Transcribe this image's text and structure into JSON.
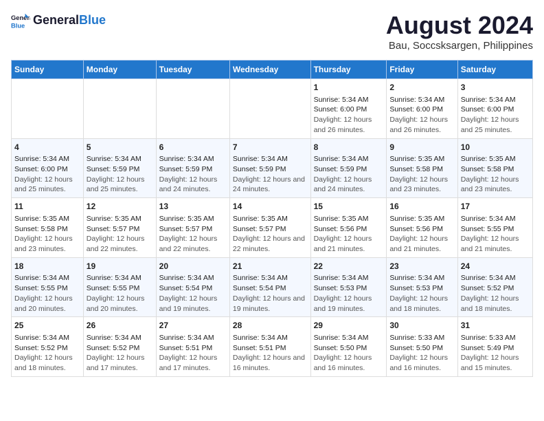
{
  "header": {
    "logo_line1": "General",
    "logo_line2": "Blue",
    "title": "August 2024",
    "subtitle": "Bau, Soccsksargen, Philippines"
  },
  "days": [
    "Sunday",
    "Monday",
    "Tuesday",
    "Wednesday",
    "Thursday",
    "Friday",
    "Saturday"
  ],
  "weeks": [
    {
      "cells": [
        {
          "empty": true
        },
        {
          "empty": true
        },
        {
          "empty": true
        },
        {
          "empty": true
        },
        {
          "day": 1,
          "sunrise": "5:34 AM",
          "sunset": "6:00 PM",
          "daylight": "12 hours and 26 minutes."
        },
        {
          "day": 2,
          "sunrise": "5:34 AM",
          "sunset": "6:00 PM",
          "daylight": "12 hours and 26 minutes."
        },
        {
          "day": 3,
          "sunrise": "5:34 AM",
          "sunset": "6:00 PM",
          "daylight": "12 hours and 25 minutes."
        }
      ]
    },
    {
      "cells": [
        {
          "day": 4,
          "sunrise": "5:34 AM",
          "sunset": "6:00 PM",
          "daylight": "12 hours and 25 minutes."
        },
        {
          "day": 5,
          "sunrise": "5:34 AM",
          "sunset": "5:59 PM",
          "daylight": "12 hours and 25 minutes."
        },
        {
          "day": 6,
          "sunrise": "5:34 AM",
          "sunset": "5:59 PM",
          "daylight": "12 hours and 24 minutes."
        },
        {
          "day": 7,
          "sunrise": "5:34 AM",
          "sunset": "5:59 PM",
          "daylight": "12 hours and 24 minutes."
        },
        {
          "day": 8,
          "sunrise": "5:34 AM",
          "sunset": "5:59 PM",
          "daylight": "12 hours and 24 minutes."
        },
        {
          "day": 9,
          "sunrise": "5:35 AM",
          "sunset": "5:58 PM",
          "daylight": "12 hours and 23 minutes."
        },
        {
          "day": 10,
          "sunrise": "5:35 AM",
          "sunset": "5:58 PM",
          "daylight": "12 hours and 23 minutes."
        }
      ]
    },
    {
      "cells": [
        {
          "day": 11,
          "sunrise": "5:35 AM",
          "sunset": "5:58 PM",
          "daylight": "12 hours and 23 minutes."
        },
        {
          "day": 12,
          "sunrise": "5:35 AM",
          "sunset": "5:57 PM",
          "daylight": "12 hours and 22 minutes."
        },
        {
          "day": 13,
          "sunrise": "5:35 AM",
          "sunset": "5:57 PM",
          "daylight": "12 hours and 22 minutes."
        },
        {
          "day": 14,
          "sunrise": "5:35 AM",
          "sunset": "5:57 PM",
          "daylight": "12 hours and 22 minutes."
        },
        {
          "day": 15,
          "sunrise": "5:35 AM",
          "sunset": "5:56 PM",
          "daylight": "12 hours and 21 minutes."
        },
        {
          "day": 16,
          "sunrise": "5:35 AM",
          "sunset": "5:56 PM",
          "daylight": "12 hours and 21 minutes."
        },
        {
          "day": 17,
          "sunrise": "5:34 AM",
          "sunset": "5:55 PM",
          "daylight": "12 hours and 21 minutes."
        }
      ]
    },
    {
      "cells": [
        {
          "day": 18,
          "sunrise": "5:34 AM",
          "sunset": "5:55 PM",
          "daylight": "12 hours and 20 minutes."
        },
        {
          "day": 19,
          "sunrise": "5:34 AM",
          "sunset": "5:55 PM",
          "daylight": "12 hours and 20 minutes."
        },
        {
          "day": 20,
          "sunrise": "5:34 AM",
          "sunset": "5:54 PM",
          "daylight": "12 hours and 19 minutes."
        },
        {
          "day": 21,
          "sunrise": "5:34 AM",
          "sunset": "5:54 PM",
          "daylight": "12 hours and 19 minutes."
        },
        {
          "day": 22,
          "sunrise": "5:34 AM",
          "sunset": "5:53 PM",
          "daylight": "12 hours and 19 minutes."
        },
        {
          "day": 23,
          "sunrise": "5:34 AM",
          "sunset": "5:53 PM",
          "daylight": "12 hours and 18 minutes."
        },
        {
          "day": 24,
          "sunrise": "5:34 AM",
          "sunset": "5:52 PM",
          "daylight": "12 hours and 18 minutes."
        }
      ]
    },
    {
      "cells": [
        {
          "day": 25,
          "sunrise": "5:34 AM",
          "sunset": "5:52 PM",
          "daylight": "12 hours and 18 minutes."
        },
        {
          "day": 26,
          "sunrise": "5:34 AM",
          "sunset": "5:52 PM",
          "daylight": "12 hours and 17 minutes."
        },
        {
          "day": 27,
          "sunrise": "5:34 AM",
          "sunset": "5:51 PM",
          "daylight": "12 hours and 17 minutes."
        },
        {
          "day": 28,
          "sunrise": "5:34 AM",
          "sunset": "5:51 PM",
          "daylight": "12 hours and 16 minutes."
        },
        {
          "day": 29,
          "sunrise": "5:34 AM",
          "sunset": "5:50 PM",
          "daylight": "12 hours and 16 minutes."
        },
        {
          "day": 30,
          "sunrise": "5:33 AM",
          "sunset": "5:50 PM",
          "daylight": "12 hours and 16 minutes."
        },
        {
          "day": 31,
          "sunrise": "5:33 AM",
          "sunset": "5:49 PM",
          "daylight": "12 hours and 15 minutes."
        }
      ]
    }
  ]
}
